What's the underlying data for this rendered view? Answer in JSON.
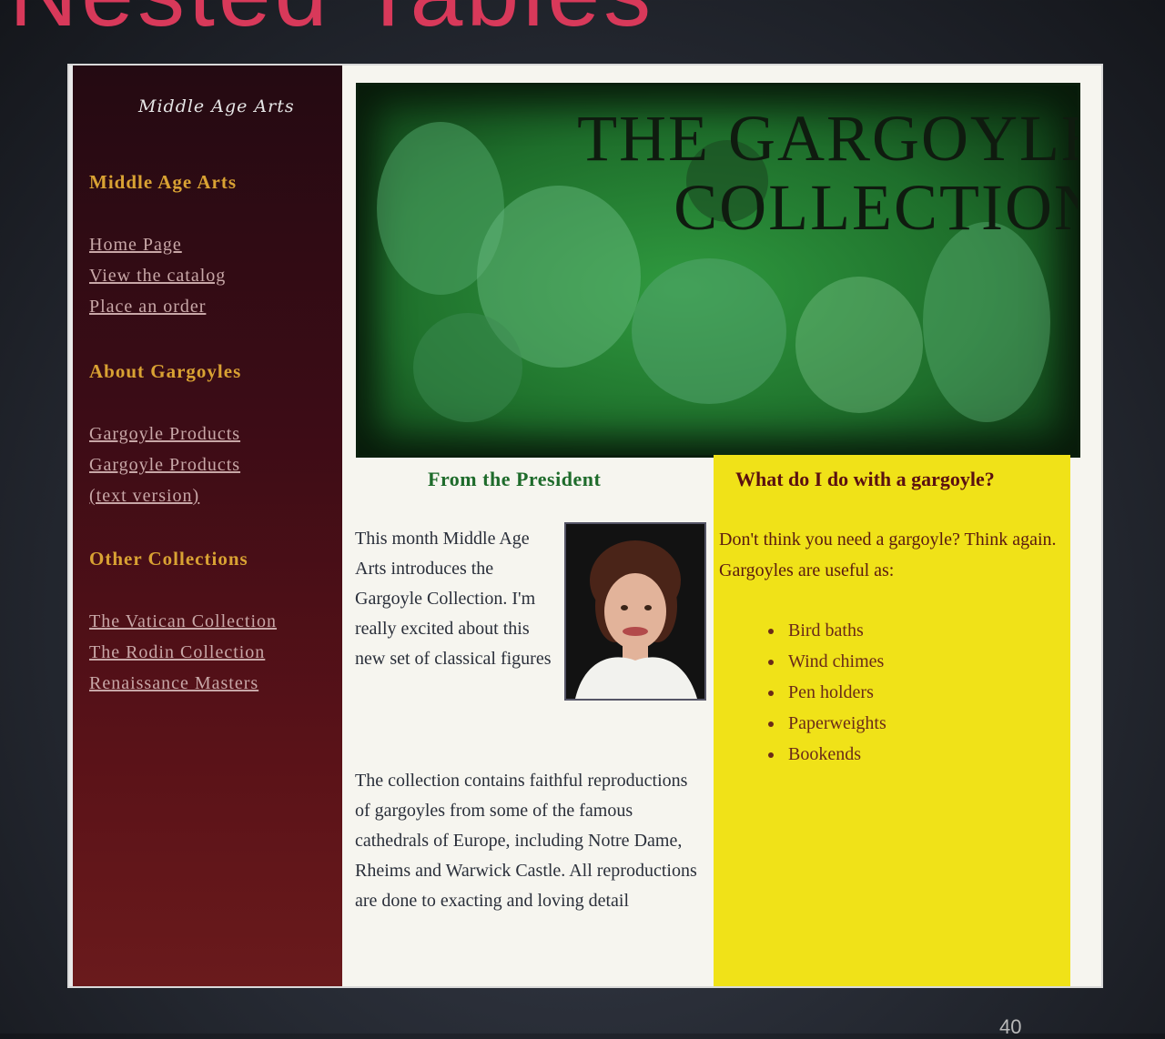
{
  "slide": {
    "title": "Nested Tables",
    "page_number": "40"
  },
  "sidebar": {
    "logo_text": "Middle Age Arts",
    "sections": [
      {
        "heading": "Middle Age Arts",
        "links": [
          "Home Page",
          "View the catalog",
          "Place an order"
        ]
      },
      {
        "heading": "About Gargoyles",
        "links": [
          "Gargoyle Products",
          "Gargoyle Products",
          "(text version)"
        ]
      },
      {
        "heading": "Other Collections",
        "links": [
          "The Vatican Collection",
          "The Rodin Collection",
          "Renaissance Masters"
        ]
      }
    ]
  },
  "banner": {
    "line1": "THE GARGOYLE",
    "line2": "COLLECTION"
  },
  "president": {
    "heading": "From the President",
    "intro": "This month Middle Age Arts introduces the Gargoyle Collection. I'm really excited about this new set of classical figures",
    "body": "The collection contains faithful reproductions of gargoyles from some of the famous cathedrals of Europe, including Notre Dame, Rheims and Warwick Castle. All reproductions are done to exacting and loving detail"
  },
  "gargoyle_uses": {
    "heading": "What do I do with a gargoyle?",
    "intro": "Don't think you need a gargoyle? Think again. Gargoyles are useful as:",
    "items": [
      "Bird baths",
      "Wind chimes",
      "Pen holders",
      "Paperweights",
      "Bookends"
    ]
  },
  "colors": {
    "sidebar_bg": "#5a1218",
    "sidebar_heading": "#d9a233",
    "yellow_panel": "#f0e218",
    "president_heading": "#1e6b2b",
    "slide_title": "#d8395a"
  }
}
